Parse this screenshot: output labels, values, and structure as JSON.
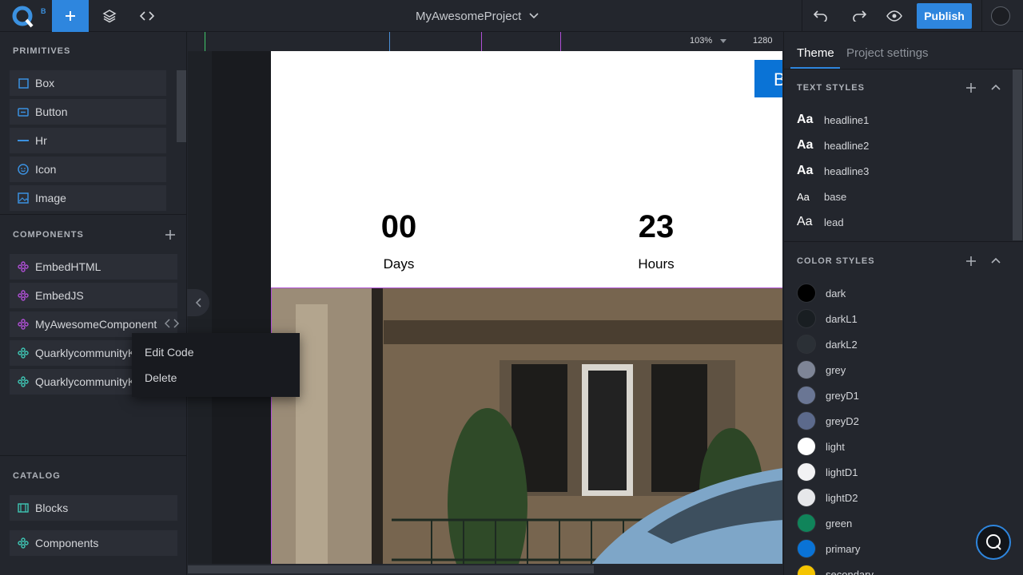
{
  "topbar": {
    "logo_badge": "B",
    "project_name": "MyAwesomeProject",
    "publish_label": "Publish"
  },
  "left": {
    "primitives_title": "PRIMITIVES",
    "primitives": [
      "Box",
      "Button",
      "Hr",
      "Icon",
      "Image"
    ],
    "components_title": "COMPONENTS",
    "components": [
      "EmbedHTML",
      "EmbedJS",
      "MyAwesomeComponent",
      "QuarklycommunityK",
      "QuarklycommunityK"
    ],
    "catalog_title": "CATALOG",
    "catalog": [
      "Blocks",
      "Components"
    ]
  },
  "canvas": {
    "zoom": "103%",
    "width": "1280",
    "button_partial": "B",
    "counters": [
      {
        "value": "00",
        "label": "Days"
      },
      {
        "value": "23",
        "label": "Hours"
      }
    ]
  },
  "context_menu": {
    "items": [
      "Edit Code",
      "Delete"
    ]
  },
  "right": {
    "tabs": [
      "Theme",
      "Project settings"
    ],
    "text_styles_title": "TEXT STYLES",
    "text_styles": [
      "headline1",
      "headline2",
      "headline3",
      "base",
      "lead"
    ],
    "aa_glyph": "Aa",
    "color_styles_title": "COLOR STYLES",
    "colors": [
      {
        "name": "dark",
        "hex": "#000000"
      },
      {
        "name": "darkL1",
        "hex": "#191e22"
      },
      {
        "name": "darkL2",
        "hex": "#2b3036"
      },
      {
        "name": "grey",
        "hex": "#7e8596"
      },
      {
        "name": "greyD1",
        "hex": "#6a7694"
      },
      {
        "name": "greyD2",
        "hex": "#5c6a8c"
      },
      {
        "name": "light",
        "hex": "#ffffff"
      },
      {
        "name": "lightD1",
        "hex": "#f2f2f4"
      },
      {
        "name": "lightD2",
        "hex": "#e6e7ea"
      },
      {
        "name": "green",
        "hex": "#10845a"
      },
      {
        "name": "primary",
        "hex": "#0a73d6"
      },
      {
        "name": "secondary",
        "hex": "#f5c400"
      }
    ]
  },
  "colors": {
    "accent": "#2e86de",
    "purple": "#b04fd6",
    "teal": "#3fc7b5"
  }
}
